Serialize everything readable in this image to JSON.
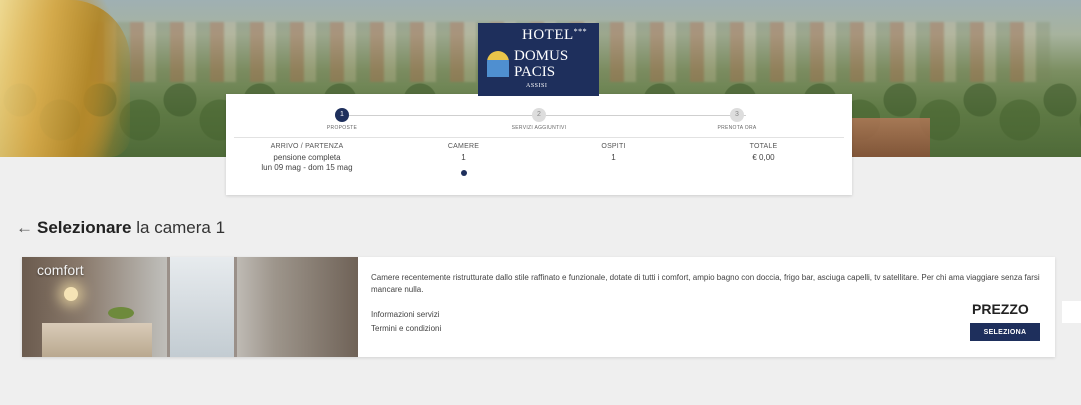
{
  "logo": {
    "hotel": "HOTEL",
    "stars": "***",
    "name_line1": "DOMUS",
    "name_line2": "PACIS",
    "city": "ASSISI"
  },
  "steps": [
    {
      "number": "1",
      "label": "PROPOSTE",
      "active": true
    },
    {
      "number": "2",
      "label": "SERVIZI AGGIUNTIVI",
      "active": false
    },
    {
      "number": "3",
      "label": "PRENOTA ORA",
      "active": false
    }
  ],
  "summary": {
    "arrival": {
      "header": "ARRIVO / PARTENZA",
      "board": "pensione completa",
      "dates": "lun 09 mag - dom 15 mag"
    },
    "rooms": {
      "header": "CAMERE",
      "value": "1"
    },
    "guests": {
      "header": "OSPITI",
      "value": "1"
    },
    "total": {
      "header": "TOTALE",
      "value": "€ 0,00"
    }
  },
  "heading": {
    "back_arrow": "←",
    "bold": "Selezionare",
    "rest": "la camera 1"
  },
  "room": {
    "tag": "comfort",
    "description": "Camere recentemente ristrutturate dallo stile raffinato e funzionale, dotate di tutti i comfort, ampio bagno con doccia, frigo bar, asciuga capelli, tv satellitare. Per chi ama viaggiare senza farsi mancare nulla.",
    "link_services": "Informazioni servizi",
    "link_terms": "Termini e condizioni",
    "price_label": "PREZZO",
    "select_label": "SELEZIONA"
  }
}
